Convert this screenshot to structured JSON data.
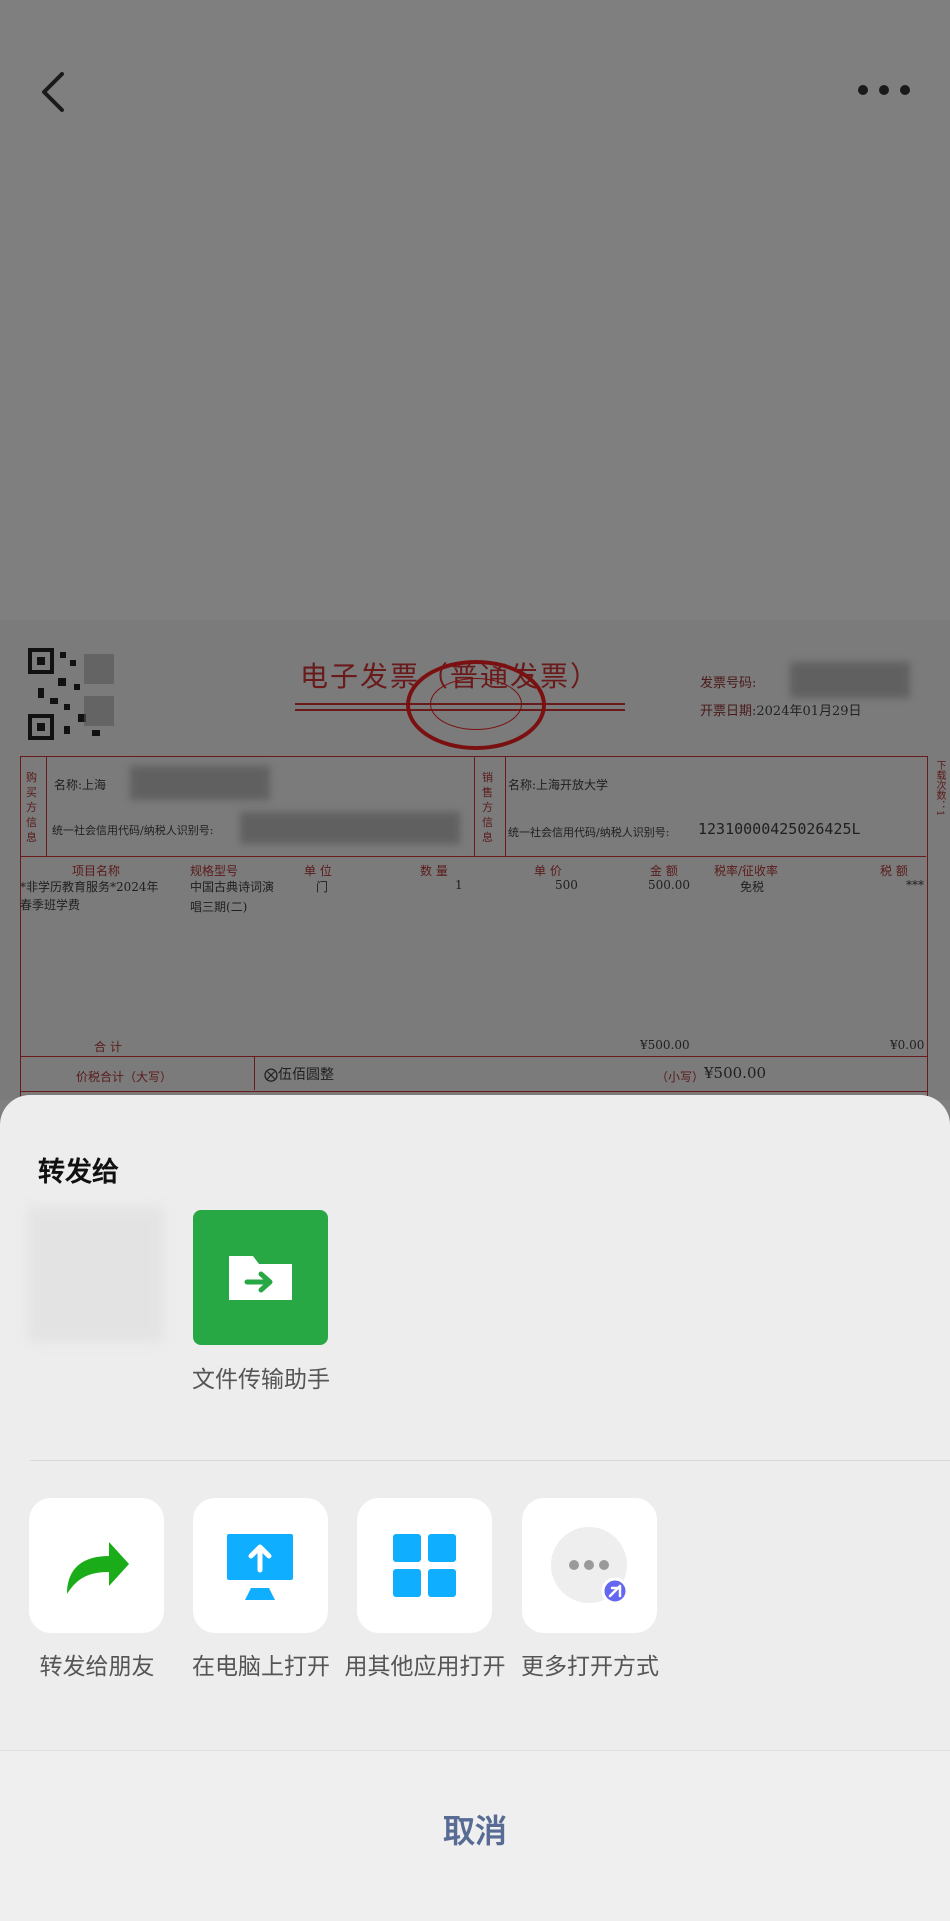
{
  "invoice": {
    "title": "电子发票（普通发票）",
    "invoice_no_label": "发票号码:",
    "issue_date_label": "开票日期:",
    "issue_date": "2024年01月29日",
    "buyer_section": "购买方信息",
    "seller_section": "销售方信息",
    "buyer_name_label": "名称:上海",
    "buyer_tax_label": "统一社会信用代码/纳税人识别号:",
    "seller_name": "名称:上海开放大学",
    "seller_tax_label": "统一社会信用代码/纳税人识别号:",
    "seller_tax_no": "12310000425026425L",
    "headers": {
      "item": "项目名称",
      "spec": "规格型号",
      "unit": "单 位",
      "qty": "数 量",
      "price": "单 价",
      "amount": "金 额",
      "rate": "税率/征收率",
      "tax": "税 额"
    },
    "row": {
      "item_line1": "*非学历教育服务*2024年",
      "item_line2": "春季班学费",
      "spec_line1": "中国古典诗词演",
      "spec_line2": "唱三期(二)",
      "unit": "门",
      "qty": "1",
      "price": "500",
      "amount": "500.00",
      "rate": "免税",
      "tax": "***"
    },
    "total_label": "合 计",
    "total_amount": "¥500.00",
    "total_tax": "¥0.00",
    "grand_label": "价税合计（大写）",
    "grand_upper": "伍佰圆整",
    "grand_lower_label": "（小写）",
    "grand_lower": "¥500.00",
    "side_note": "下载次数：1"
  },
  "sheet": {
    "share_title": "转发给",
    "file_helper": "文件传输助手",
    "actions": [
      {
        "label": "转发给朋友",
        "icon": "share-arrow-icon",
        "color": "#1aad19"
      },
      {
        "label": "在电脑上打开",
        "icon": "monitor-upload-icon",
        "color": "#10aeff"
      },
      {
        "label": "用其他应用打开",
        "icon": "grid-apps-icon",
        "color": "#10aeff"
      },
      {
        "label": "更多打开方式",
        "icon": "more-dots-icon",
        "color": "#6467f0"
      }
    ],
    "cancel": "取消"
  }
}
